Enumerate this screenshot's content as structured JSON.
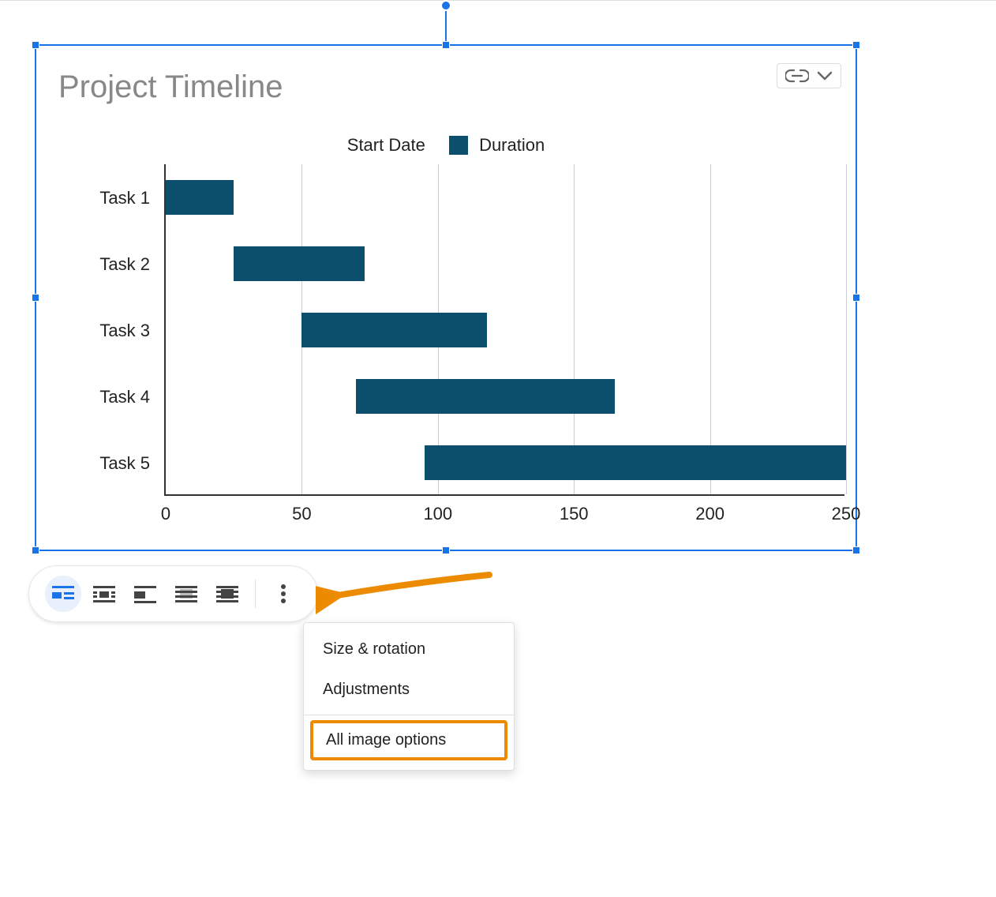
{
  "chart_data": {
    "type": "bar",
    "orientation": "horizontal",
    "stacked": true,
    "title": "Project Timeline",
    "categories": [
      "Task 1",
      "Task 2",
      "Task 3",
      "Task 4",
      "Task 5"
    ],
    "series": [
      {
        "name": "Start Date",
        "values": [
          0,
          25,
          50,
          70,
          95
        ],
        "color": "transparent"
      },
      {
        "name": "Duration",
        "values": [
          25,
          48,
          68,
          95,
          155
        ],
        "color": "#0b4f6c"
      }
    ],
    "xticks": [
      0,
      50,
      100,
      150,
      200,
      250
    ],
    "xlim": [
      0,
      250
    ],
    "xlabel": "",
    "ylabel": ""
  },
  "link_dropdown": {
    "present": true
  },
  "toolbar": {
    "options": [
      {
        "id": "inline",
        "icon": "wrap-inline-icon",
        "active": true
      },
      {
        "id": "wrap",
        "icon": "wrap-square-icon",
        "active": false
      },
      {
        "id": "break",
        "icon": "wrap-break-icon",
        "active": false
      },
      {
        "id": "behind",
        "icon": "wrap-behind-icon",
        "active": false
      },
      {
        "id": "front",
        "icon": "wrap-front-icon",
        "active": false
      }
    ],
    "more": "more-vertical-icon"
  },
  "menu": {
    "items": [
      {
        "label": "Size & rotation",
        "highlight": false
      },
      {
        "label": "Adjustments",
        "highlight": false
      }
    ],
    "footer": {
      "label": "All image options",
      "highlight": true
    }
  },
  "annotation": {
    "type": "arrow",
    "color": "#ed8b00"
  }
}
